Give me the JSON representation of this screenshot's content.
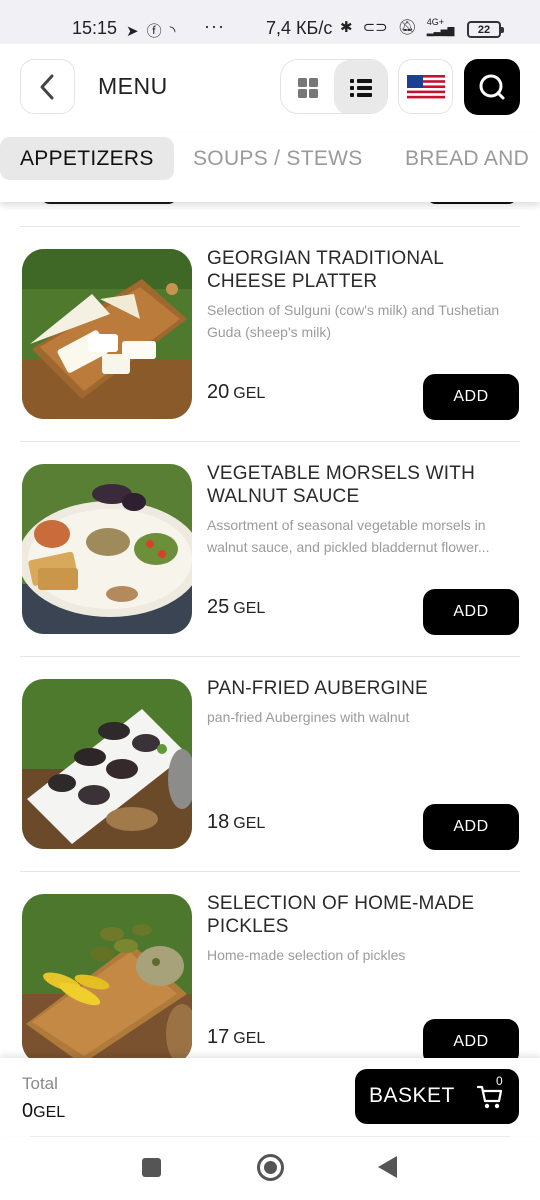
{
  "status_bar": {
    "time": "15:15",
    "network_speed": "7,4 КБ/с",
    "network_type": "4G+",
    "battery": "22",
    "more": "···"
  },
  "header": {
    "title": "MENU",
    "icons": [
      "chevron-left-icon",
      "grid-view-icon",
      "list-view-icon",
      "us-flag-icon",
      "search-icon"
    ]
  },
  "tabs": [
    {
      "label": "APPETIZERS",
      "active": true
    },
    {
      "label": "SOUPS / STEWS",
      "active": false
    },
    {
      "label": "BREAD AND",
      "active": false
    }
  ],
  "items": [
    {
      "title": "GEORGIAN TRADITIONAL CHEESE PLATTER",
      "description": "Selection of Sulguni (cow's milk) and Tushetian Guda (sheep's milk)",
      "price": "20",
      "currency": "GEL",
      "add_label": "ADD"
    },
    {
      "title": "VEGETABLE MORSELS WITH WALNUT SAUCE",
      "description": "Assortment of seasonal vegetable morsels in walnut sauce, and pickled bladdernut flower...",
      "price": "25",
      "currency": "GEL",
      "add_label": "ADD"
    },
    {
      "title": "PAN-FRIED AUBERGINE",
      "description": "pan-fried Aubergines with walnut",
      "price": "18",
      "currency": "GEL",
      "add_label": "ADD"
    },
    {
      "title": "SELECTION OF HOME-MADE PICKLES",
      "description": "Home-made selection of pickles",
      "price": "17",
      "currency": "GEL",
      "add_label": "ADD"
    }
  ],
  "footer": {
    "total_label": "Total",
    "total_value": "0",
    "total_currency": "GEL",
    "basket_label": "BASKET",
    "basket_count": "0"
  },
  "colors": {
    "primary": "#000000",
    "tab_active_bg": "#e8e8e8",
    "muted_text": "#9b9b9b",
    "grass": "#4f7a2e",
    "wood": "#8a5a2b"
  }
}
